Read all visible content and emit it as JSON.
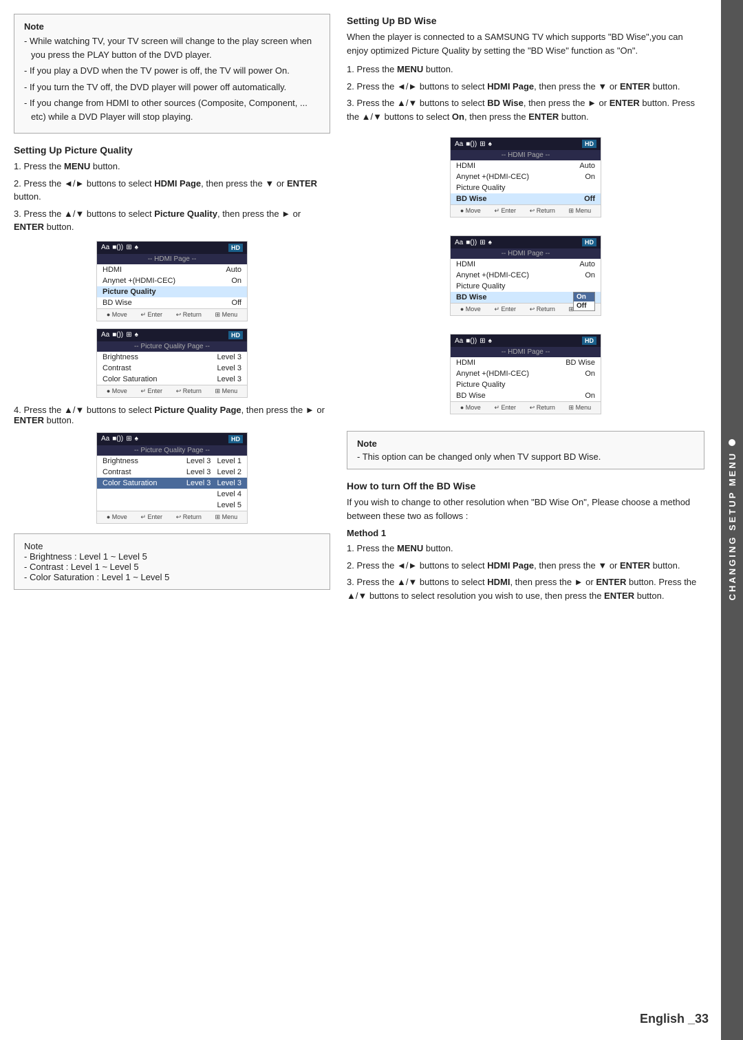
{
  "page": {
    "title": "Changing Setup Menu",
    "footer": "English _33",
    "sidebar_label": "CHANGING SETUP MENU"
  },
  "left_note": {
    "title": "Note",
    "items": [
      "While watching TV, your TV screen will change to the play screen when you press the PLAY button of the DVD player.",
      "If you play a DVD when the TV power is off, the TV will power On.",
      "If you turn the TV off, the DVD player will power off automatically.",
      "If you change from HDMI to other sources (Composite, Component, ... etc) while a DVD Player will stop  playing."
    ]
  },
  "setting_picture": {
    "title": "Setting Up Picture Quality",
    "steps": [
      {
        "num": "1.",
        "text": "Press the ",
        "bold": "MENU",
        "after": " button."
      },
      {
        "num": "2.",
        "text": "Press the ◄/► buttons to select ",
        "bold": "HDMI Page",
        "after": ", then press the ▼ or ",
        "bold2": "ENTER",
        "after2": " button."
      },
      {
        "num": "3.",
        "text": "Press the ▲/▼ buttons to select ",
        "bold": "Picture Quality",
        "after": ", then press the ► or ",
        "bold2": "ENTER",
        "after2": " button."
      }
    ],
    "screen1": {
      "header_icons": "Aa ■())) ⊞ ♠",
      "hd": "HD",
      "subheader": "-- HDMI Page --",
      "rows": [
        {
          "label": "HDMI",
          "value": "Auto",
          "highlighted": false
        },
        {
          "label": "Anynet +(HDMI-CEC)",
          "value": "On",
          "highlighted": false
        },
        {
          "label": "Picture Quality",
          "value": "",
          "highlighted": true
        },
        {
          "label": "BD Wise",
          "value": "Off",
          "highlighted": false
        }
      ],
      "footer": [
        "● Move",
        "↵ Enter",
        "↩ Return",
        "⊞ Menu"
      ]
    },
    "screen2": {
      "header_icons": "Aa ■())) ⊞ ♠",
      "hd": "HD",
      "subheader": "-- Picture Quality Page --",
      "rows": [
        {
          "label": "Brightness",
          "value": "Level 3",
          "highlighted": false
        },
        {
          "label": "Contrast",
          "value": "Level 3",
          "highlighted": false
        },
        {
          "label": "Color Saturation",
          "value": "Level 3",
          "highlighted": false
        }
      ],
      "footer": [
        "● Move",
        "↵ Enter",
        "↩ Return",
        "⊞ Menu"
      ]
    },
    "step4_text": "Press the ▲/▼ buttons to select ",
    "step4_bold": "Picture Quality Page",
    "step4_after": ", then press the ► or ",
    "step4_bold2": "ENTER",
    "step4_after2": " button.",
    "screen3": {
      "header_icons": "Aa ■())) ⊞ ♠",
      "hd": "HD",
      "subheader": "-- Picture Quality Page --",
      "rows": [
        {
          "label": "Brightness",
          "value": "Level 3",
          "extra": "Level 1",
          "highlighted": false
        },
        {
          "label": "Contrast",
          "value": "Level 3",
          "extra": "Level 2",
          "highlighted": false
        },
        {
          "label": "Color Saturation",
          "value": "Level 3",
          "extra": "Level 3",
          "highlighted": true
        }
      ],
      "dropdown": [
        "Level 4",
        "Level 5"
      ],
      "footer": [
        "● Move",
        "↵ Enter",
        "↩ Return",
        "⊞ Menu"
      ]
    }
  },
  "bottom_left_note": {
    "title": "Note",
    "items": [
      "Brightness : Level 1 ~ Level  5",
      "Contrast : Level  1 ~ Level  5",
      "Color Saturation : Level  1 ~ Level  5"
    ]
  },
  "setting_bd": {
    "title": "Setting Up BD Wise",
    "intro": "When the player is connected to a SAMSUNG TV which supports \"BD Wise\",you can enjoy optimized Picture Quality by setting the \"BD Wise\" function as \"On\".",
    "steps": [
      {
        "num": "1.",
        "text": "Press the ",
        "bold": "MENU",
        "after": " button."
      },
      {
        "num": "2.",
        "text": "Press the ◄/► buttons to select ",
        "bold": "HDMI Page",
        "after": ", then press the ▼ or ",
        "bold2": "ENTER",
        "after2": " button."
      },
      {
        "num": "3.",
        "text": "Press the ▲/▼ buttons to select ",
        "bold": "BD Wise",
        "after": ", then press the ► or ",
        "bold2": "ENTER",
        "after2": " button. Press the ▲/▼ buttons to select ",
        "bold3": "On",
        "after3": ", then press the ",
        "bold4": "ENTER",
        "after4": " button."
      }
    ],
    "screen1": {
      "subheader": "-- HDMI Page --",
      "rows": [
        {
          "label": "HDMI",
          "value": "Auto"
        },
        {
          "label": "Anynet +(HDMI-CEC)",
          "value": "On"
        },
        {
          "label": "Picture Quality",
          "value": ""
        },
        {
          "label": "BD Wise",
          "value": "Off",
          "highlighted": true
        }
      ],
      "footer": [
        "● Move",
        "↵ Enter",
        "↩ Return",
        "⊞ Menu"
      ]
    },
    "screen2": {
      "subheader": "-- HDMI Page --",
      "rows": [
        {
          "label": "HDMI",
          "value": "Auto"
        },
        {
          "label": "Anynet +(HDMI-CEC)",
          "value": "On"
        },
        {
          "label": "Picture Quality",
          "value": ""
        },
        {
          "label": "BD Wise",
          "value": "On",
          "highlighted": true
        }
      ],
      "dropdown": [
        "On",
        "Off"
      ],
      "active_option": "On",
      "footer": [
        "● Move",
        "↵ Enter",
        "↩ Return",
        "⊞ Menu"
      ]
    },
    "screen3": {
      "subheader": "-- HDMI Page --",
      "rows": [
        {
          "label": "HDMI",
          "value": "BD Wise"
        },
        {
          "label": "Anynet +(HDMI-CEC)",
          "value": "On"
        },
        {
          "label": "Picture Quality",
          "value": ""
        },
        {
          "label": "BD Wise",
          "value": "On",
          "highlighted": false
        }
      ],
      "footer": [
        "● Move",
        "↵ Enter",
        "↩ Return",
        "⊞ Menu"
      ]
    }
  },
  "right_note": {
    "title": "Note",
    "text": "This option can be changed only when TV support BD Wise."
  },
  "how_to": {
    "title": "How to turn Off the BD Wise",
    "intro": "If you wish to change to other resolution when \"BD Wise On\", Please choose a method between these two as follows :",
    "method1": {
      "title": "Method 1",
      "steps": [
        {
          "num": "1.",
          "text": "Press the ",
          "bold": "MENU",
          "after": " button."
        },
        {
          "num": "2.",
          "text": "Press the ◄/► buttons to select ",
          "bold": "HDMI Page",
          "after": ", then press the ▼ or ",
          "bold2": "ENTER",
          "after2": " button."
        },
        {
          "num": "3.",
          "text": "Press the ▲/▼ buttons to select ",
          "bold": "HDMI",
          "after": ", then press the ► or ",
          "bold2": "ENTER",
          "after2": " button. Press the ▲/▼ buttons to select resolution you wish to use, then press the ",
          "bold3": "ENTER",
          "after3": " button."
        }
      ]
    }
  }
}
